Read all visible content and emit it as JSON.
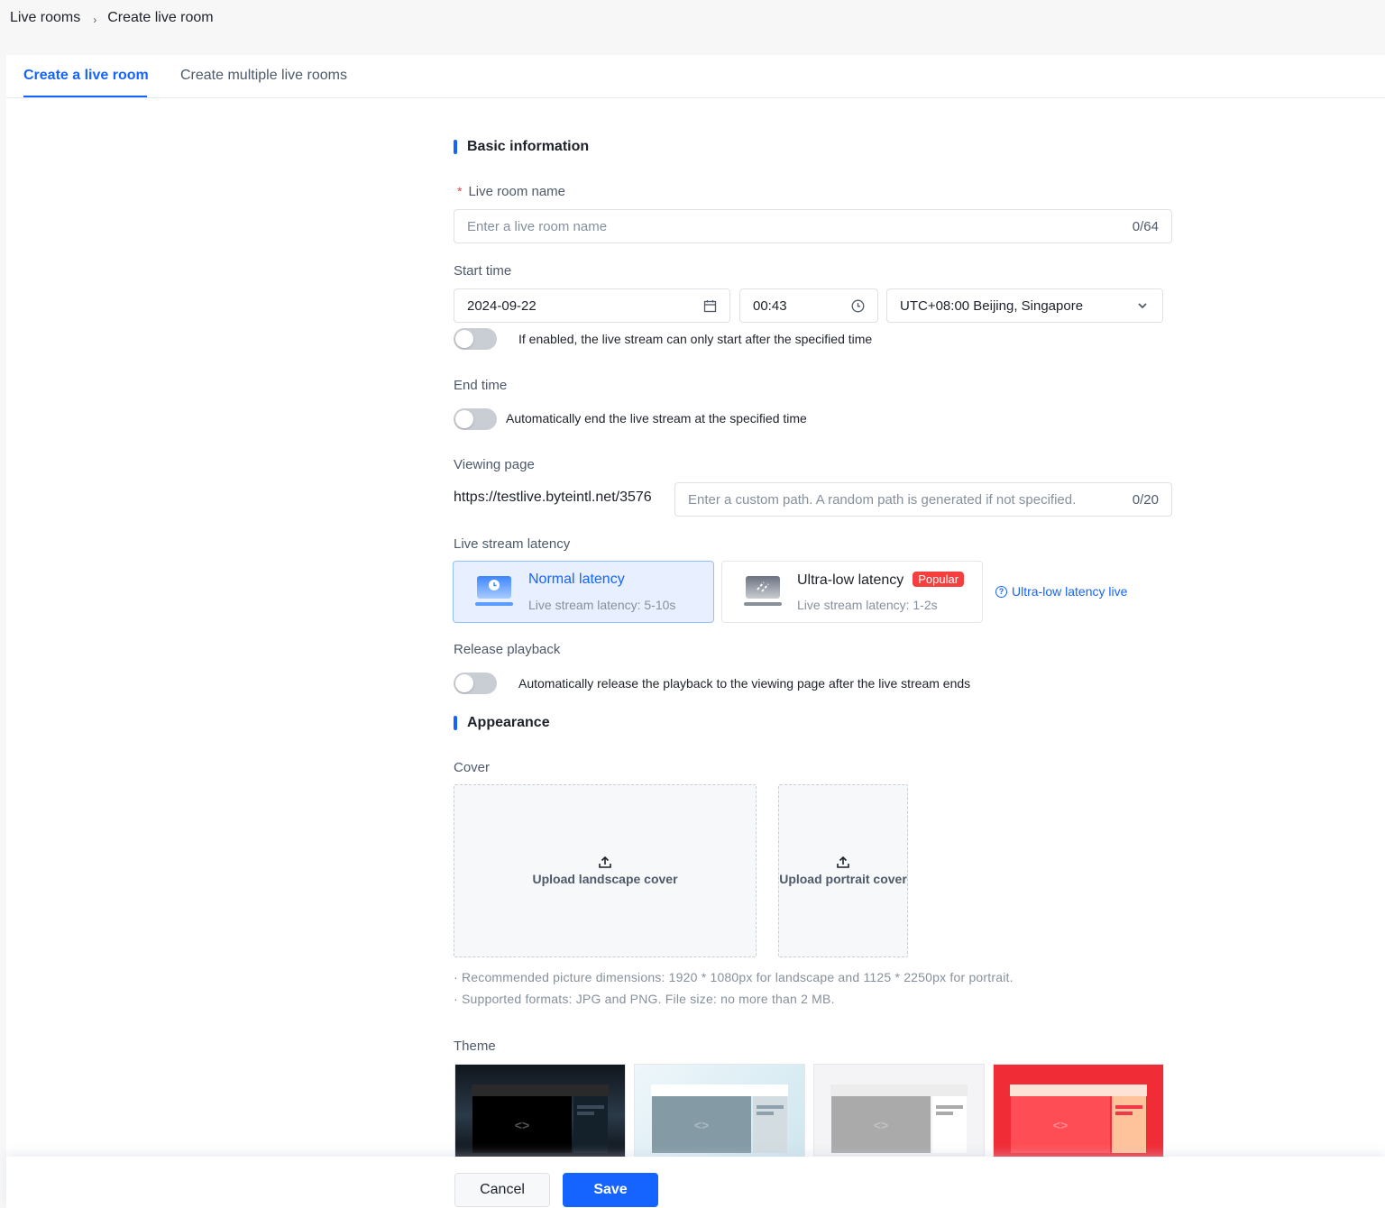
{
  "breadcrumb": {
    "items": [
      "Live rooms",
      "Create live room"
    ],
    "separator": "›"
  },
  "tabs": [
    {
      "label": "Create a live room",
      "active": true
    },
    {
      "label": "Create multiple live rooms",
      "active": false
    }
  ],
  "basic": {
    "title": "Basic information",
    "name": {
      "label": "Live room name",
      "required_mark": "*",
      "placeholder": "Enter a live room name",
      "value": "",
      "count": "0/64"
    },
    "start_time": {
      "label": "Start time",
      "date": "2024-09-22",
      "time": "00:43",
      "timezone": "UTC+08:00 Beijing, Singapore",
      "switch_on": false,
      "hint": "If enabled, the live stream can only start after the specified time"
    },
    "end_time": {
      "label": "End time",
      "switch_on": false,
      "hint": "Automatically end the live stream at the specified time"
    },
    "viewing_page": {
      "label": "Viewing page",
      "prefix": "https://testlive.byteintl.net/3576",
      "placeholder": "Enter a custom path. A random path is generated if not specified.",
      "value": "",
      "count": "0/20"
    },
    "latency": {
      "label": "Live stream latency",
      "options": [
        {
          "title": "Normal latency",
          "sub": "Live stream latency: 5-10s",
          "selected": true,
          "icon": "clock-laptop-icon"
        },
        {
          "title": "Ultra-low latency",
          "badge": "Popular",
          "sub": "Live stream latency: 1-2s",
          "selected": false,
          "icon": "fast-laptop-icon"
        }
      ],
      "help_link": "Ultra-low latency live"
    },
    "playback": {
      "label": "Release playback",
      "switch_on": false,
      "hint": "Automatically release the playback to the viewing page after the live stream ends"
    }
  },
  "appearance": {
    "title": "Appearance",
    "cover": {
      "label": "Cover",
      "landscape_label": "Upload landscape cover",
      "portrait_label": "Upload portrait cover",
      "notes": [
        "· Recommended picture dimensions: 1920 * 1080px for landscape and 1125 * 2250px for portrait.",
        "· Supported formats: JPG and PNG. File size: no more than 2 MB."
      ]
    },
    "theme": {
      "label": "Theme",
      "options": [
        {
          "name": "dark",
          "colors": {
            "bg": "#1a2430",
            "top": "#2a2a2a",
            "video": "#000000",
            "side": "#14202a",
            "line": "#3a4a58",
            "logo": "#555555"
          }
        },
        {
          "name": "light-blue",
          "colors": {
            "bg": "#dcecf3",
            "top": "#ffffff",
            "video": "#849aa5",
            "side": "#d3dde1",
            "line": "#8ea2ad",
            "logo": "#a9bac2"
          }
        },
        {
          "name": "light-gray",
          "colors": {
            "bg": "#f4f4f6",
            "top": "#ececec",
            "video": "#aaaaaa",
            "side": "#ffffff",
            "line": "#aaaaaa",
            "logo": "#c2c2c2"
          }
        },
        {
          "name": "festive-red",
          "colors": {
            "bg": "#f02d37",
            "top": "#fde2d6",
            "video": "#ff4d55",
            "side": "#ffc39c",
            "line": "#f0384a",
            "logo": "#ff8a8e"
          }
        }
      ]
    }
  },
  "footer": {
    "cancel": "Cancel",
    "save": "Save"
  },
  "colors": {
    "primary": "#1664ff",
    "danger": "#f53f3f"
  }
}
